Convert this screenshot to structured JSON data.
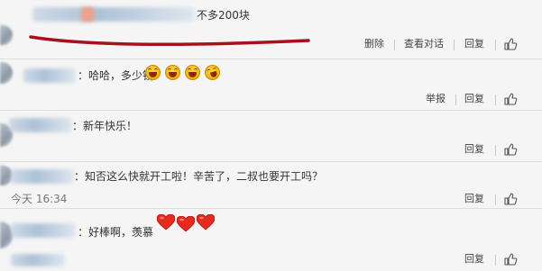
{
  "comments": [
    {
      "text": "不多200块",
      "actions": {
        "delete": "删除",
        "view_conversation": "查看对话",
        "reply": "回复"
      }
    },
    {
      "text": "：哈哈，多少钱",
      "actions": {
        "report": "举报",
        "reply": "回复"
      }
    },
    {
      "text": "：新年快乐！",
      "actions": {
        "reply": "回复"
      }
    },
    {
      "text": "：知否这么快就开工啦！辛苦了，二叔也要开工吗？",
      "timestamp": "今天 16:34",
      "actions": {
        "reply": "回复"
      }
    },
    {
      "text": "：好棒啊，羡慕",
      "actions": {
        "reply": "回复"
      }
    }
  ],
  "colors": {
    "background": "#f5f5f5",
    "text": "#333333",
    "underline": "#a8101e",
    "heart": "#e8291d",
    "emoji": "#f5b300"
  },
  "icons": [
    "like-icon",
    "laughing-emoji",
    "heart-emoji"
  ]
}
